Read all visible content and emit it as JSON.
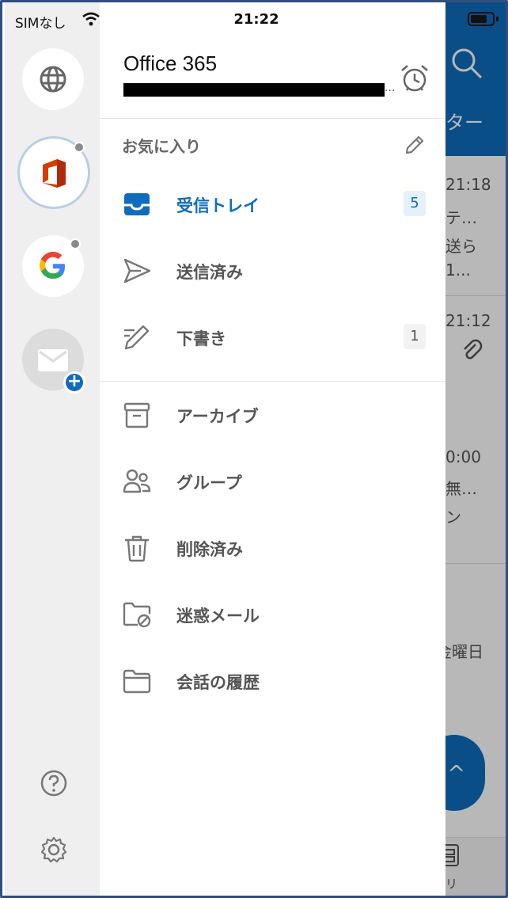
{
  "status_bar": {
    "carrier": "SIMなし",
    "time": "21:22"
  },
  "account_rail": {
    "accounts": [
      {
        "name": "globe-account"
      },
      {
        "name": "office-account",
        "selected": true
      },
      {
        "name": "google-account"
      },
      {
        "name": "add-mail-account"
      }
    ]
  },
  "drawer": {
    "account_name": "Office 365",
    "account_email_suffix": "...",
    "favorites_title": "お気に入り",
    "favorites": [
      {
        "label": "受信トレイ",
        "badge": "5",
        "icon": "inbox-icon",
        "active": true
      },
      {
        "label": "送信済み",
        "badge": "",
        "icon": "send-icon"
      },
      {
        "label": "下書き",
        "badge": "1",
        "icon": "draft-pencil-icon"
      }
    ],
    "folders": [
      {
        "label": "アーカイブ",
        "icon": "archive-icon"
      },
      {
        "label": "グループ",
        "icon": "group-icon"
      },
      {
        "label": "削除済み",
        "icon": "trash-icon"
      },
      {
        "label": "迷惑メール",
        "icon": "junk-folder-icon"
      },
      {
        "label": "会話の履歴",
        "icon": "folder-icon"
      }
    ]
  },
  "background": {
    "header_fragment": "ター",
    "rows": [
      {
        "time": "21:18",
        "line1": "テ…",
        "line2": "送ら",
        "line3": "1..."
      },
      {
        "time": "21:12"
      },
      {
        "time": "0:00",
        "line1": "無…",
        "line2": "ン"
      },
      {
        "line1": "金曜日"
      }
    ],
    "tab_fragment": "リ"
  },
  "colors": {
    "accent": "#0f6cbd",
    "rail": "#efefef"
  }
}
